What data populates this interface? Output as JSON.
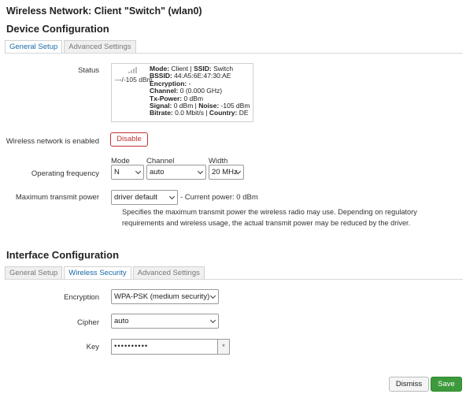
{
  "page_title": "Wireless Network: Client \"Switch\" (wlan0)",
  "device": {
    "heading": "Device Configuration",
    "tabs": [
      "General Setup",
      "Advanced Settings"
    ],
    "active_tab": 0,
    "status": {
      "label": "Status",
      "signal_dbm": "---/-105 dBm",
      "line1": {
        "k1": "Mode:",
        "v1": " Client | ",
        "k2": "SSID:",
        "v2": " Switch"
      },
      "line2": {
        "k": "BSSID:",
        "v": " 44:A5:6E:47:30:AE"
      },
      "line3": {
        "k": "Encryption:",
        "v": " -"
      },
      "line4": {
        "k": "Channel:",
        "v": " 0 (0.000 GHz)"
      },
      "line5": {
        "k": "Tx-Power:",
        "v": " 0 dBm"
      },
      "line6": {
        "k1": "Signal:",
        "v1": " 0 dBm | ",
        "k2": "Noise:",
        "v2": " -105 dBm"
      },
      "line7": {
        "k1": "Bitrate:",
        "v1": " 0.0 Mbit/s | ",
        "k2": "Country:",
        "v2": " DE"
      }
    },
    "enabled": {
      "label": "Wireless network is enabled",
      "button": "Disable"
    },
    "frequency": {
      "label": "Operating frequency",
      "mode_label": "Mode",
      "mode_value": "N",
      "channel_label": "Channel",
      "channel_value": "auto",
      "width_label": "Width",
      "width_value": "20 MHz"
    },
    "txpower": {
      "label": "Maximum transmit power",
      "value": "driver default",
      "current": "- Current power: 0 dBm",
      "help": "Specifies the maximum transmit power the wireless radio may use. Depending on regulatory requirements and wireless usage, the actual transmit power may be reduced by the driver."
    }
  },
  "interface": {
    "heading": "Interface Configuration",
    "tabs": [
      "General Setup",
      "Wireless Security",
      "Advanced Settings"
    ],
    "active_tab": 1,
    "encryption": {
      "label": "Encryption",
      "value": "WPA-PSK (medium security)"
    },
    "cipher": {
      "label": "Cipher",
      "value": "auto"
    },
    "key": {
      "label": "Key",
      "value": "••••••••••",
      "toggle": "*"
    }
  },
  "footer": {
    "dismiss": "Dismiss",
    "save": "Save"
  },
  "icons": {
    "signal": "signal-strength-icon",
    "dropdown": "chevron-down-icon"
  },
  "colors": {
    "accent": "#1a6aa6",
    "danger": "#c23030",
    "save": "#3c9a3c"
  }
}
